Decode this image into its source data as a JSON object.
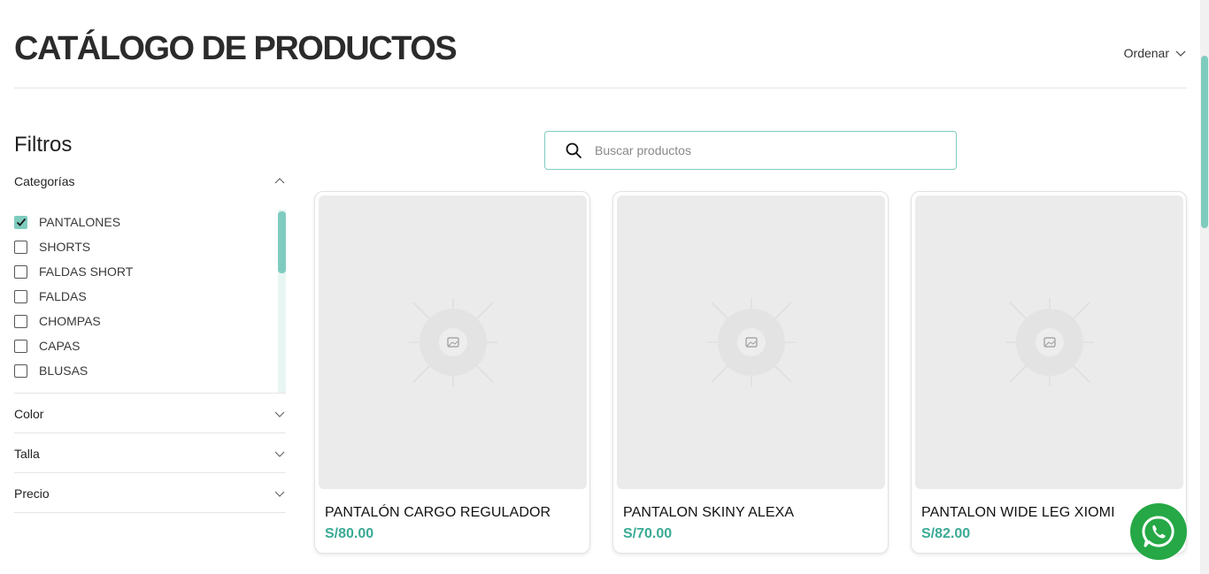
{
  "header": {
    "title": "CATÁLOGO DE PRODUCTOS",
    "sort_label": "Ordenar"
  },
  "sidebar": {
    "title": "Filtros",
    "categories": {
      "label": "Categorías",
      "expanded": true,
      "items": [
        {
          "label": "PANTALONES",
          "checked": true
        },
        {
          "label": "SHORTS",
          "checked": false
        },
        {
          "label": "FALDAS SHORT",
          "checked": false
        },
        {
          "label": "FALDAS",
          "checked": false
        },
        {
          "label": "CHOMPAS",
          "checked": false
        },
        {
          "label": "CAPAS",
          "checked": false
        },
        {
          "label": "BLUSAS",
          "checked": false
        }
      ]
    },
    "sections": [
      {
        "label": "Color",
        "expanded": false
      },
      {
        "label": "Talla",
        "expanded": false
      },
      {
        "label": "Precio",
        "expanded": false
      }
    ]
  },
  "search": {
    "placeholder": "Buscar productos",
    "value": ""
  },
  "products": [
    {
      "name": "PANTALÓN CARGO REGULADOR",
      "price": "S/80.00"
    },
    {
      "name": "PANTALON SKINY ALEXA",
      "price": "S/70.00"
    },
    {
      "name": "PANTALON WIDE LEG XIOMI",
      "price": "S/82.00"
    }
  ],
  "colors": {
    "accent": "#7fccbf",
    "price": "#3aaa95",
    "whatsapp": "#25a845"
  },
  "icons": {
    "sort": "chevron-down-icon",
    "search": "search-icon",
    "categories_toggle": "chevron-up-icon",
    "section_toggle": "chevron-down-icon",
    "image_placeholder": "image-placeholder-icon",
    "chat": "whatsapp-icon"
  }
}
